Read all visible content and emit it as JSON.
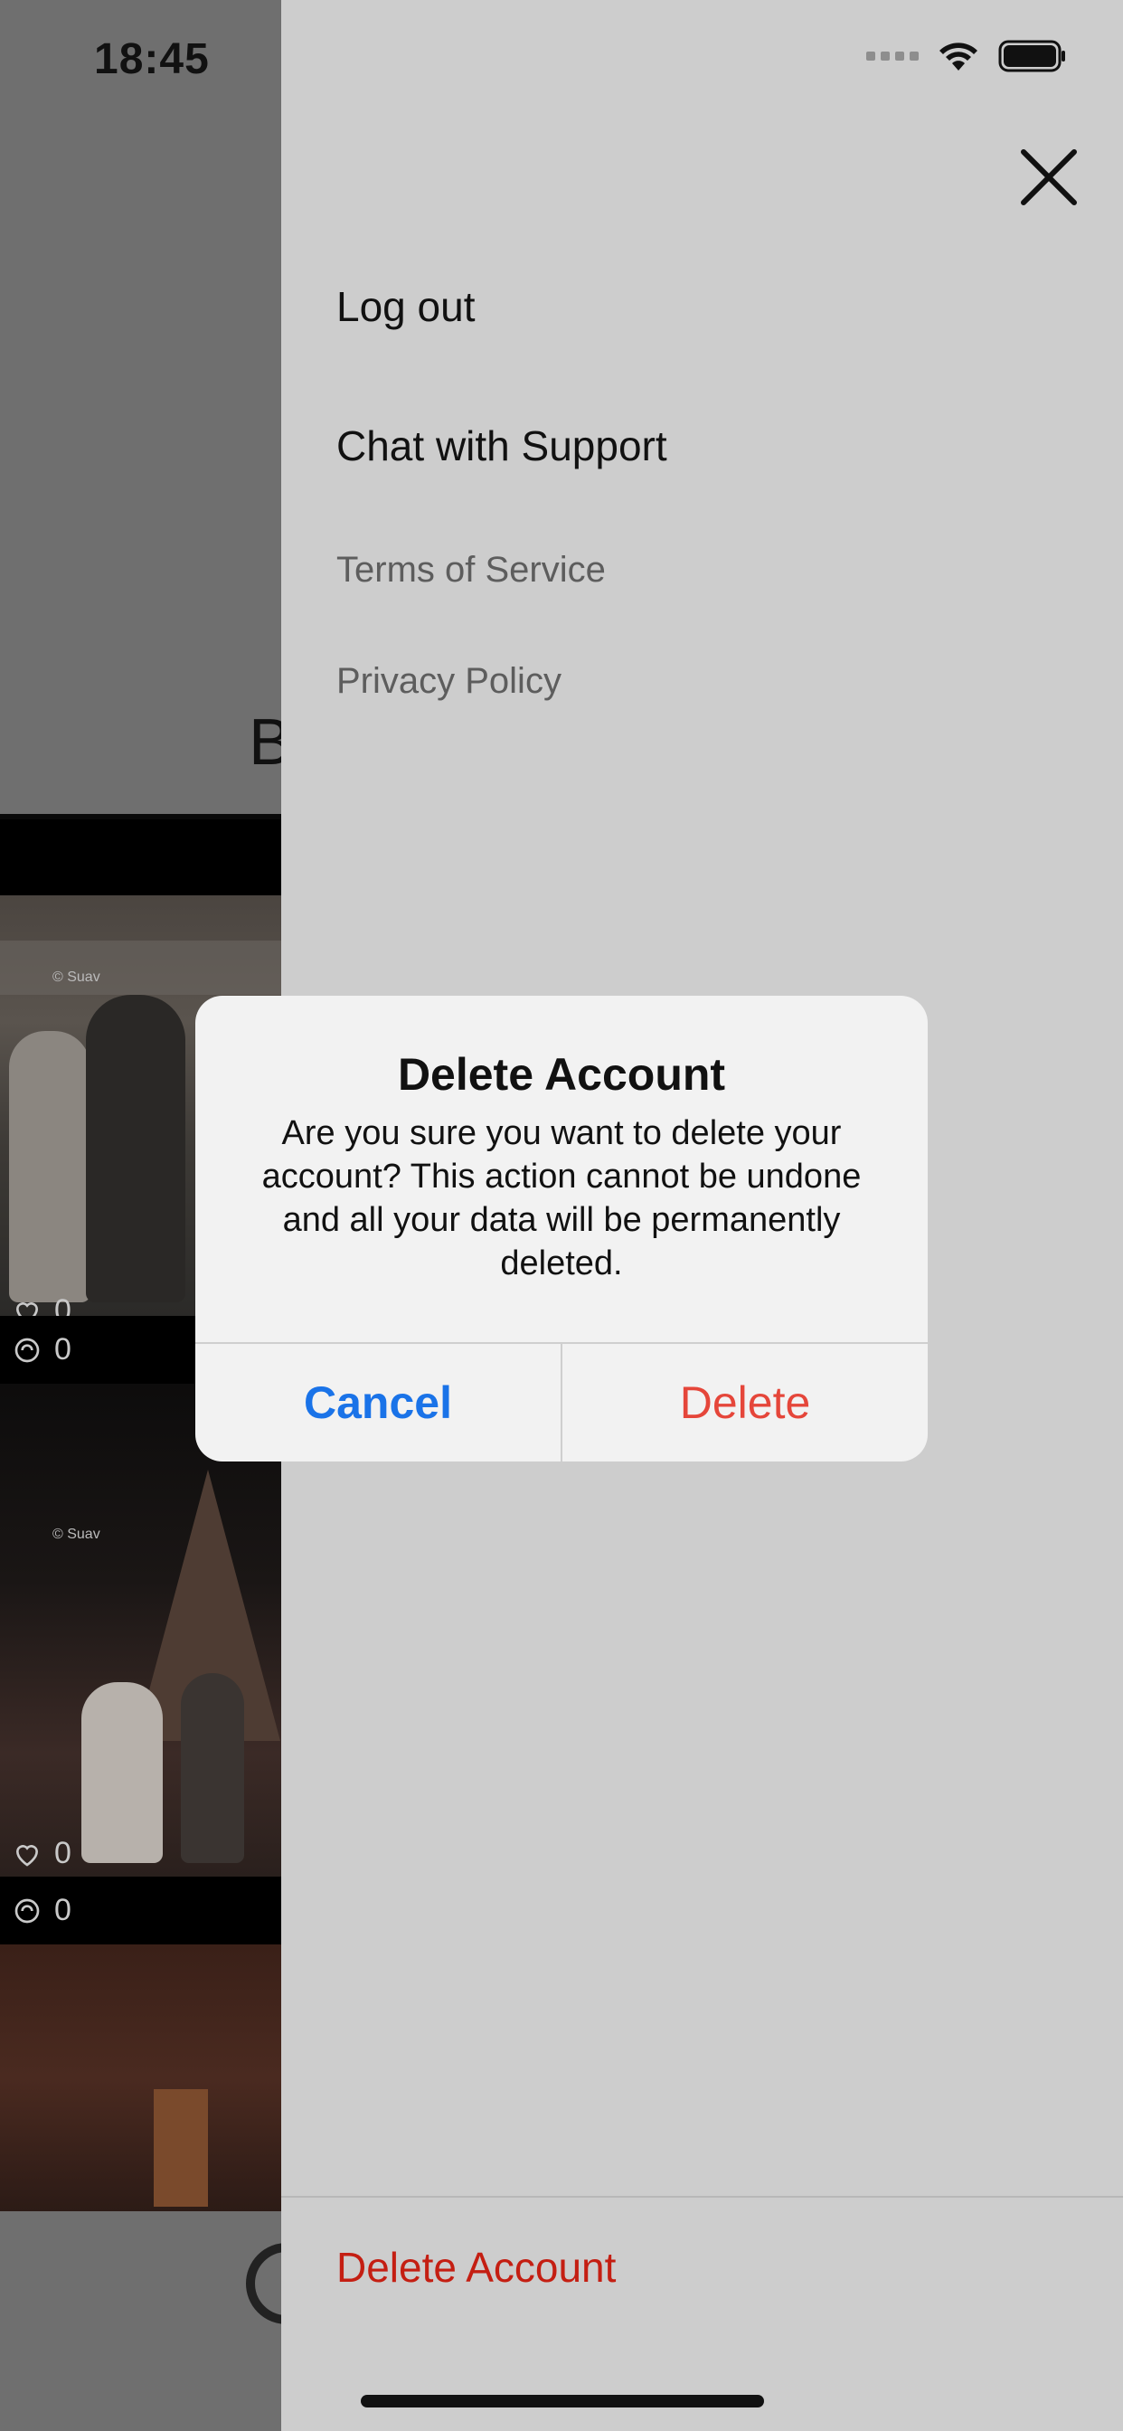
{
  "status_bar": {
    "time": "18:45"
  },
  "background_feed": {
    "partial_heading": "B",
    "posts": [
      {
        "watermark": "© Suav",
        "likes": "0",
        "reposts": "0"
      },
      {
        "watermark": "© Suav",
        "likes": "0",
        "reposts": "0"
      },
      {}
    ]
  },
  "drawer": {
    "menu": [
      {
        "id": "logout",
        "label": "Log out"
      },
      {
        "id": "support",
        "label": "Chat with Support"
      },
      {
        "id": "tos",
        "label": "Terms of Service"
      },
      {
        "id": "privacy",
        "label": "Privacy Policy"
      }
    ],
    "delete_account_label": "Delete Account",
    "close_icon": "close-icon"
  },
  "alert": {
    "title": "Delete Account",
    "message": "Are you sure you want to delete your account? This action cannot be undone and all your data will be permanently deleted.",
    "cancel_label": "Cancel",
    "delete_label": "Delete"
  },
  "colors": {
    "destructive_red": "#c41e12",
    "alert_delete_red": "#e5463a",
    "ios_blue": "#1a73e8",
    "drawer_bg": "#cdcdcd"
  }
}
